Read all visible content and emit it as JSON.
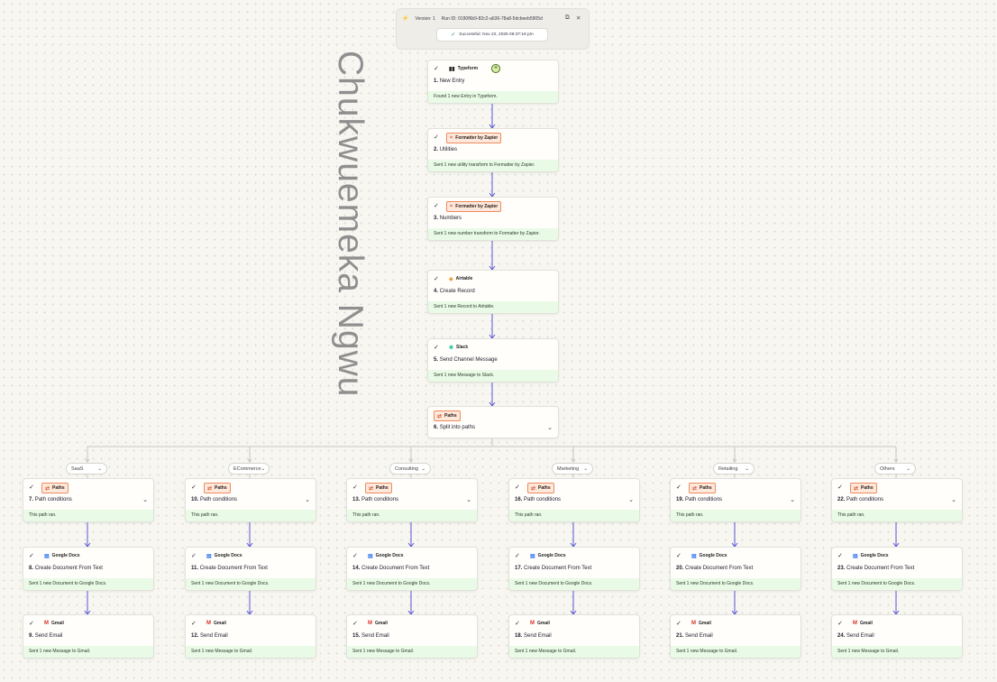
{
  "header": {
    "version": "Version: 1",
    "run_id": "Run ID: 0190f6b9-82c2-a636-78a8-5dcbeeb5905d",
    "status": "Successful",
    "timestamp": "Nov 22, 2025 08:37:18 pm",
    "icons": [
      "zap-icon",
      "external-link-icon",
      "close-icon"
    ]
  },
  "watermark": "Chukwuemeka Ngwu",
  "main_steps": [
    {
      "app": "Typeform",
      "icon": "typeform-icon",
      "num": "1.",
      "title": "New Entry",
      "footer": "Found 1 new Entry in Typeform.",
      "plus": true
    },
    {
      "app": "Formatter by Zapier",
      "icon": "formatter-icon",
      "num": "2.",
      "title": "Utilities",
      "footer": "Sent 1 new utility transform to Formatter by Zapier."
    },
    {
      "app": "Formatter by Zapier",
      "icon": "formatter-icon",
      "num": "3.",
      "title": "Numbers",
      "footer": "Sent 1 new number transform to Formatter by Zapier."
    },
    {
      "app": "Airtable",
      "icon": "airtable-icon",
      "num": "4.",
      "title": "Create Record",
      "footer": "Sent 1 new Record to Airtable."
    },
    {
      "app": "Slack",
      "icon": "slack-icon",
      "num": "5.",
      "title": "Send Channel Message",
      "footer": "Sent 1 new Message to Slack."
    },
    {
      "app": "Paths",
      "icon": "paths-icon",
      "num": "6.",
      "title": "Split into paths",
      "footer": ""
    }
  ],
  "paths": [
    {
      "label": "SaaS",
      "steps": [
        {
          "app": "Paths",
          "num": "7.",
          "title": "Path conditions",
          "footer": "This path ran."
        },
        {
          "app": "Google Docs",
          "num": "8.",
          "title": "Create Document From Text",
          "footer": "Sent 1 new Document to Google Docs."
        },
        {
          "app": "Gmail",
          "num": "9.",
          "title": "Send Email",
          "footer": "Sent 1 new Message to Gmail."
        }
      ]
    },
    {
      "label": "ECommerce",
      "steps": [
        {
          "app": "Paths",
          "num": "10.",
          "title": "Path conditions",
          "footer": "This path ran."
        },
        {
          "app": "Google Docs",
          "num": "11.",
          "title": "Create Document From Text",
          "footer": "Sent 1 new Document to Google Docs."
        },
        {
          "app": "Gmail",
          "num": "12.",
          "title": "Send Email",
          "footer": "Sent 1 new Message to Gmail."
        }
      ]
    },
    {
      "label": "Consulting",
      "steps": [
        {
          "app": "Paths",
          "num": "13.",
          "title": "Path conditions",
          "footer": "This path ran."
        },
        {
          "app": "Google Docs",
          "num": "14.",
          "title": "Create Document From Text",
          "footer": "Sent 1 new Document to Google Docs."
        },
        {
          "app": "Gmail",
          "num": "15.",
          "title": "Send Email",
          "footer": "Sent 1 new Message to Gmail."
        }
      ]
    },
    {
      "label": "Marketing",
      "steps": [
        {
          "app": "Paths",
          "num": "16.",
          "title": "Path conditions",
          "footer": "This path ran."
        },
        {
          "app": "Google Docs",
          "num": "17.",
          "title": "Create Document From Text",
          "footer": "Sent 1 new Document to Google Docs."
        },
        {
          "app": "Gmail",
          "num": "18.",
          "title": "Send Email",
          "footer": "Sent 1 new Message to Gmail."
        }
      ]
    },
    {
      "label": "Retailing",
      "steps": [
        {
          "app": "Paths",
          "num": "19.",
          "title": "Path conditions",
          "footer": "This path ran."
        },
        {
          "app": "Google Docs",
          "num": "20.",
          "title": "Create Document From Text",
          "footer": "Sent 1 new Document to Google Docs."
        },
        {
          "app": "Gmail",
          "num": "21.",
          "title": "Send Email",
          "footer": "Sent 1 new Message to Gmail."
        }
      ]
    },
    {
      "label": "Others",
      "steps": [
        {
          "app": "Paths",
          "num": "22.",
          "title": "Path conditions",
          "footer": "This path ran."
        },
        {
          "app": "Google Docs",
          "num": "23.",
          "title": "Create Document From Text",
          "footer": "Sent 1 new Document to Google Docs."
        },
        {
          "app": "Gmail",
          "num": "24.",
          "title": "Send Email",
          "footer": "Sent 1 new Message to Gmail."
        }
      ]
    }
  ],
  "colors": {
    "success_footer": "#e9fbe6",
    "arrow": "#5b56d6",
    "connector": "#c9c7c0",
    "badge_orange": "#fde8dc"
  }
}
